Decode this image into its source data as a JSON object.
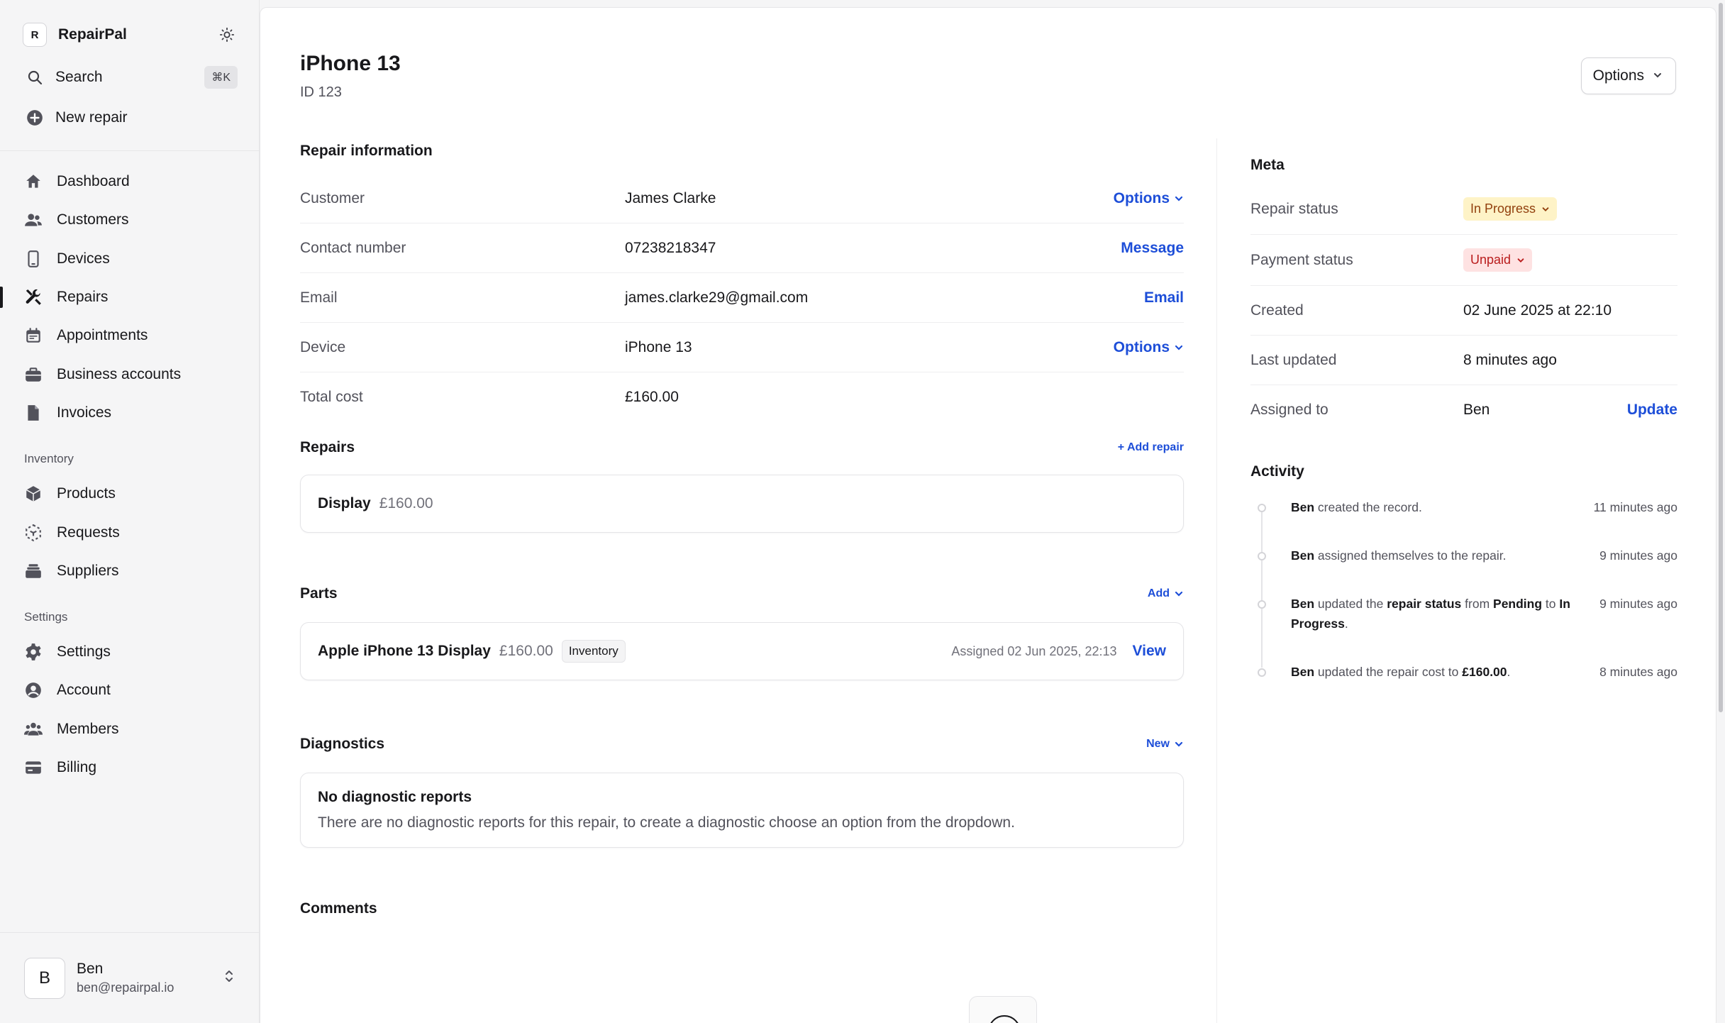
{
  "brand": {
    "logo_letter": "R",
    "name": "RepairPal"
  },
  "top_actions": {
    "search_label": "Search",
    "search_shortcut": "⌘K",
    "new_repair_label": "New repair"
  },
  "nav": {
    "main": [
      {
        "label": "Dashboard",
        "icon": "home-icon"
      },
      {
        "label": "Customers",
        "icon": "users-icon"
      },
      {
        "label": "Devices",
        "icon": "phone-icon"
      },
      {
        "label": "Repairs",
        "icon": "wrench-screwdriver-icon",
        "active": true
      },
      {
        "label": "Appointments",
        "icon": "calendar-icon"
      },
      {
        "label": "Business accounts",
        "icon": "briefcase-icon"
      },
      {
        "label": "Invoices",
        "icon": "document-icon"
      }
    ],
    "inventory_heading": "Inventory",
    "inventory": [
      {
        "label": "Products",
        "icon": "cube-icon"
      },
      {
        "label": "Requests",
        "icon": "dashed-cube-icon"
      },
      {
        "label": "Suppliers",
        "icon": "stack-icon"
      }
    ],
    "settings_heading": "Settings",
    "settings": [
      {
        "label": "Settings",
        "icon": "gear-icon"
      },
      {
        "label": "Account",
        "icon": "user-circle-icon"
      },
      {
        "label": "Members",
        "icon": "group-icon"
      },
      {
        "label": "Billing",
        "icon": "credit-card-icon"
      }
    ]
  },
  "user": {
    "initial": "B",
    "name": "Ben",
    "email": "ben@repairpal.io"
  },
  "header": {
    "title": "iPhone 13",
    "subtitle": "ID 123",
    "options_label": "Options"
  },
  "repair_info": {
    "title": "Repair information",
    "rows": [
      {
        "label": "Customer",
        "value": "James Clarke",
        "action": "Options"
      },
      {
        "label": "Contact number",
        "value": "07238218347",
        "action": "Message"
      },
      {
        "label": "Email",
        "value": "james.clarke29@gmail.com",
        "action": "Email"
      },
      {
        "label": "Device",
        "value": "iPhone 13",
        "action": "Options"
      },
      {
        "label": "Total cost",
        "value": "£160.00",
        "action": ""
      }
    ]
  },
  "repairs": {
    "title": "Repairs",
    "add_label": "+ Add repair",
    "item": {
      "name": "Display",
      "price": "£160.00"
    }
  },
  "parts": {
    "title": "Parts",
    "add_label": "Add",
    "item": {
      "name": "Apple iPhone 13 Display",
      "price": "£160.00",
      "badge": "Inventory",
      "assigned": "Assigned 02 Jun 2025, 22:13",
      "view_label": "View"
    }
  },
  "diagnostics": {
    "title": "Diagnostics",
    "new_label": "New",
    "empty_title": "No diagnostic reports",
    "empty_text": "There are no diagnostic reports for this repair, to create a diagnostic choose an option from the dropdown."
  },
  "comments": {
    "title": "Comments"
  },
  "meta": {
    "title": "Meta",
    "repair_status_label": "Repair status",
    "repair_status": "In Progress",
    "payment_status_label": "Payment status",
    "payment_status": "Unpaid",
    "created_label": "Created",
    "created": "02 June 2025 at 22:10",
    "updated_label": "Last updated",
    "updated": "8 minutes ago",
    "assigned_label": "Assigned to",
    "assigned": "Ben",
    "update_label": "Update",
    "colors": {
      "in_progress_bg": "#fef3c7",
      "unpaid_bg": "#fee2e2",
      "link": "#1d4ed8"
    }
  },
  "activity": {
    "title": "Activity",
    "items": [
      {
        "actor": "Ben",
        "t1": " created the record.",
        "time": "11 minutes ago"
      },
      {
        "actor": "Ben",
        "t1": " assigned themselves to the repair.",
        "time": "9 minutes ago"
      },
      {
        "actor": "Ben",
        "t1": " updated the ",
        "b1": "repair status",
        "t2": " from ",
        "b2": "Pending",
        "t3": " to ",
        "b3": "In Progress",
        "t4": ".",
        "time": "9 minutes ago"
      },
      {
        "actor": "Ben",
        "t1": " updated the repair cost to ",
        "b1": "£160.00",
        "t2": ".",
        "time": "8 minutes ago"
      }
    ]
  }
}
